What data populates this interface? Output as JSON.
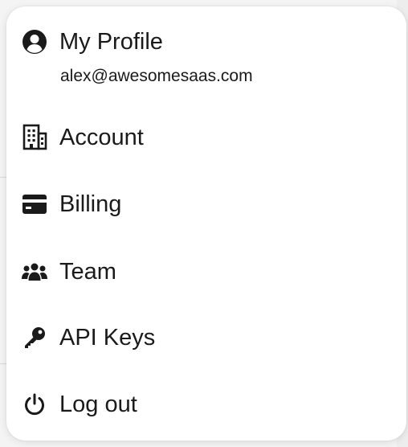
{
  "menu": {
    "profile": {
      "label": "My Profile",
      "email": "alex@awesomesaas.com",
      "icon": "user-circle-icon"
    },
    "items": [
      {
        "label": "Account",
        "icon": "building-icon"
      },
      {
        "label": "Billing",
        "icon": "credit-card-icon"
      },
      {
        "label": "Team",
        "icon": "users-icon"
      },
      {
        "label": "API Keys",
        "icon": "key-icon"
      },
      {
        "label": "Log out",
        "icon": "power-icon"
      }
    ]
  },
  "colors": {
    "text": "#1a1a1a",
    "menu_background": "#ffffff",
    "page_background": "#f4f4f4"
  }
}
